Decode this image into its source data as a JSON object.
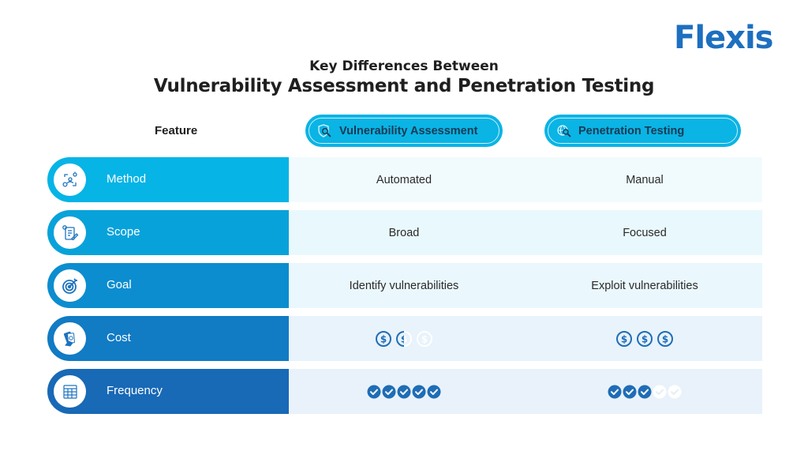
{
  "brand": {
    "logo_text": "Flexis",
    "color": "#1d6fc0"
  },
  "header": {
    "subtitle": "Key Differences Between",
    "title": "Vulnerability Assessment and Penetration Testing"
  },
  "table": {
    "feature_header": "Feature",
    "columns": [
      {
        "label": "Vulnerability Assessment",
        "icon": "shield-search-icon"
      },
      {
        "label": "Penetration Testing",
        "icon": "globe-search-icon"
      }
    ],
    "rows": [
      {
        "feature": "Method",
        "icon": "workflow-icon",
        "bar_color": "#06b4e6",
        "bg_color": "#f1fbfe",
        "va": {
          "type": "text",
          "value": "Automated"
        },
        "pt": {
          "type": "text",
          "value": "Manual"
        }
      },
      {
        "feature": "Scope",
        "icon": "checklist-icon",
        "bar_color": "#08a2da",
        "bg_color": "#e9f8fd",
        "va": {
          "type": "text",
          "value": "Broad"
        },
        "pt": {
          "type": "text",
          "value": "Focused"
        }
      },
      {
        "feature": "Goal",
        "icon": "target-icon",
        "bar_color": "#0c8dcf",
        "bg_color": "#eaf7fd",
        "va": {
          "type": "text",
          "value": "Identify vulnerabilities"
        },
        "pt": {
          "type": "text",
          "value": "Exploit vulnerabilities"
        }
      },
      {
        "feature": "Cost",
        "icon": "money-hand-icon",
        "bar_color": "#117bc4",
        "bg_color": "#e8f3fb",
        "va": {
          "type": "dollar-rating",
          "value": 1.5,
          "max": 3
        },
        "pt": {
          "type": "dollar-rating",
          "value": 3,
          "max": 3
        }
      },
      {
        "feature": "Frequency",
        "icon": "calendar-grid-icon",
        "bar_color": "#1869b6",
        "bg_color": "#e9f2fa",
        "va": {
          "type": "check-rating",
          "value": 5,
          "max": 5
        },
        "pt": {
          "type": "check-rating",
          "value": 3,
          "max": 5
        }
      }
    ],
    "rating_color": "#1f6db5",
    "rating_empty_color": "#ffffff"
  }
}
